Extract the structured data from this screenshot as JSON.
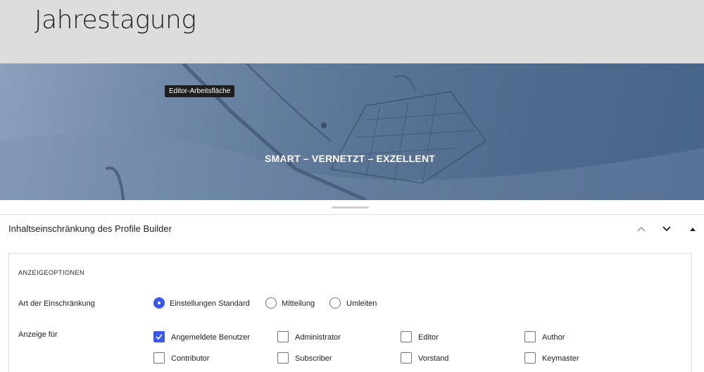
{
  "header": {
    "site_title": "Jahrestagung"
  },
  "hero": {
    "tooltip": "Editor-Arbeitsfläche",
    "heading": "SMART – VERNETZT – EXZELLENT"
  },
  "panel": {
    "title": "Inhaltseinschränkung des Profile Builder",
    "move_up_icon": "chevron-up-icon",
    "move_down_icon": "chevron-down-icon",
    "toggle_icon": "triangle-up-icon"
  },
  "display_options": {
    "heading": "ANZEIGEOPTIONEN",
    "restriction_type": {
      "label": "Art der Einschränkung",
      "options": [
        {
          "label": "Einstellungen Standard",
          "checked": true
        },
        {
          "label": "Mitteilung",
          "checked": false
        },
        {
          "label": "Umleiten",
          "checked": false
        }
      ]
    },
    "display_for": {
      "label": "Anzeige für",
      "options": [
        {
          "label": "Angemeldete Benutzer",
          "checked": true
        },
        {
          "label": "Administrator",
          "checked": false
        },
        {
          "label": "Editor",
          "checked": false
        },
        {
          "label": "Author",
          "checked": false
        },
        {
          "label": "Contributor",
          "checked": false
        },
        {
          "label": "Subscriber",
          "checked": false
        },
        {
          "label": "Vorstand",
          "checked": false
        },
        {
          "label": "Keymaster",
          "checked": false
        }
      ]
    }
  },
  "colors": {
    "accent": "#3858e9",
    "header_bg": "#dddddd"
  }
}
